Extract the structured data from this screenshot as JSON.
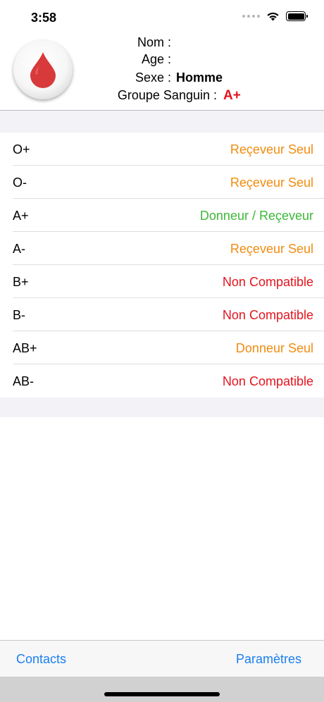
{
  "status_bar": {
    "time": "3:58",
    "icons": [
      "cellular-signal-icon",
      "wifi-icon",
      "battery-icon"
    ]
  },
  "profile": {
    "logo_icon": "blood-drop-icon",
    "fields": [
      {
        "label": "Nom :",
        "value": ""
      },
      {
        "label": "Age :",
        "value": ""
      },
      {
        "label": "Sexe :",
        "value": "Homme"
      },
      {
        "label": "Groupe Sanguin :",
        "value": "A+"
      }
    ]
  },
  "compatibility": {
    "rows": [
      {
        "type": "O+",
        "status": "Reçeveur Seul"
      },
      {
        "type": "O-",
        "status": "Reçeveur Seul"
      },
      {
        "type": "A+",
        "status": "Donneur / Reçeveur"
      },
      {
        "type": "A-",
        "status": "Reçeveur Seul"
      },
      {
        "type": "B+",
        "status": "Non Compatible"
      },
      {
        "type": "B-",
        "status": "Non Compatible"
      },
      {
        "type": "AB+",
        "status": "Donneur Seul"
      },
      {
        "type": "AB-",
        "status": "Non Compatible"
      }
    ]
  },
  "tab_bar": {
    "left_label": "Contacts",
    "right_label": "Paramètres"
  },
  "colors": {
    "receveur": "#f08c10",
    "donneur_receveur": "#3cb838",
    "non_compatible": "#e3141e",
    "donneur": "#f08c10",
    "blood_group": "#e3141e",
    "link": "#1a7ff0"
  }
}
